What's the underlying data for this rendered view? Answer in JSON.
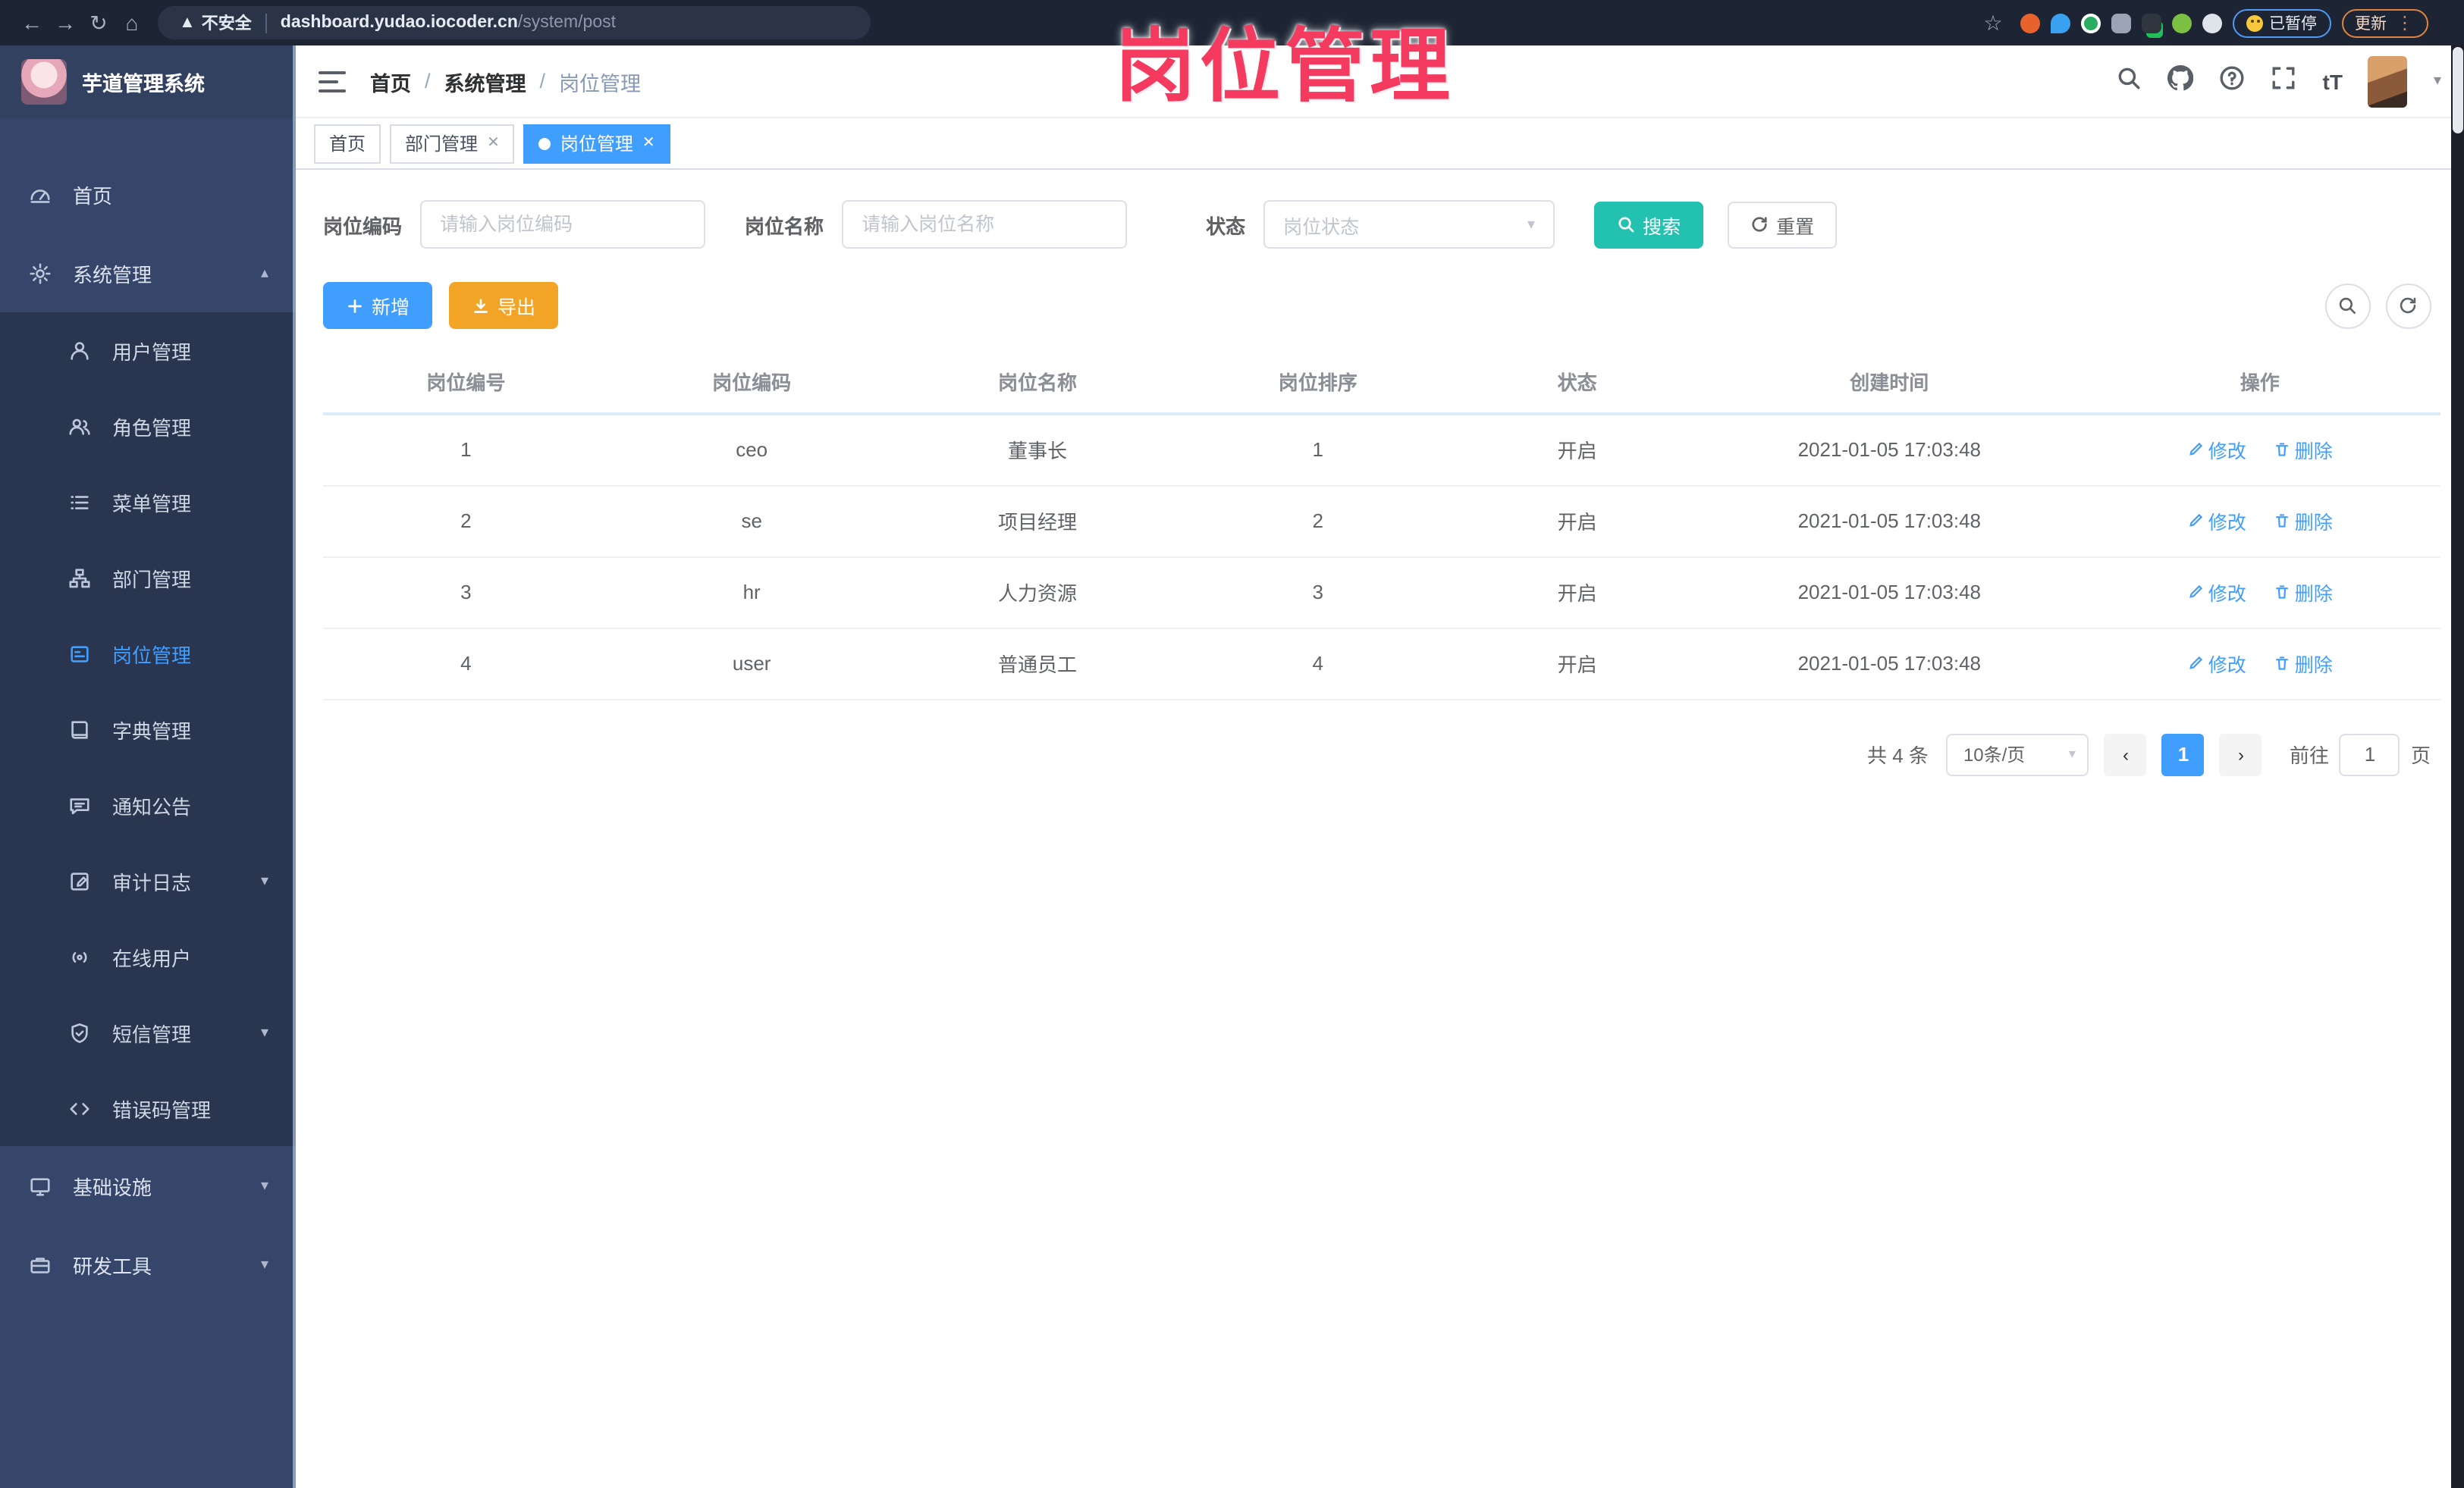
{
  "colors": {
    "accent": "#409eff",
    "search_teal": "#22c1b0",
    "export_orange": "#f2a426",
    "watermark_pink": "#f43a5f",
    "sidebar_bg": "#36466a",
    "submenu_bg": "#2a3650"
  },
  "watermark": "岗位管理",
  "browser": {
    "security_label": "不安全",
    "url_host": "dashboard.yudao.iocoder.cn",
    "url_path": "/system/post",
    "paused_label": "已暂停",
    "update_label": "更新"
  },
  "app": {
    "title": "芋道管理系统"
  },
  "breadcrumb": {
    "items": [
      "首页",
      "系统管理",
      "岗位管理"
    ]
  },
  "tabs": [
    {
      "label": "首页"
    },
    {
      "label": "部门管理"
    },
    {
      "label": "岗位管理"
    }
  ],
  "sidebar": {
    "items": [
      {
        "label": "首页"
      },
      {
        "label": "系统管理"
      },
      {
        "label": "用户管理"
      },
      {
        "label": "角色管理"
      },
      {
        "label": "菜单管理"
      },
      {
        "label": "部门管理"
      },
      {
        "label": "岗位管理"
      },
      {
        "label": "字典管理"
      },
      {
        "label": "通知公告"
      },
      {
        "label": "审计日志"
      },
      {
        "label": "在线用户"
      },
      {
        "label": "短信管理"
      },
      {
        "label": "错误码管理"
      },
      {
        "label": "基础设施"
      },
      {
        "label": "研发工具"
      }
    ]
  },
  "filters": {
    "post_code": {
      "label": "岗位编码",
      "placeholder": "请输入岗位编码",
      "value": ""
    },
    "post_name": {
      "label": "岗位名称",
      "placeholder": "请输入岗位名称",
      "value": ""
    },
    "status": {
      "label": "状态",
      "placeholder": "岗位状态"
    },
    "search_label": "搜索",
    "reset_label": "重置"
  },
  "toolbar": {
    "add_label": "新增",
    "export_label": "导出"
  },
  "table": {
    "headers": [
      "岗位编号",
      "岗位编码",
      "岗位名称",
      "岗位排序",
      "状态",
      "创建时间",
      "操作"
    ],
    "action_edit": "修改",
    "action_delete": "删除",
    "rows": [
      {
        "id": "1",
        "code": "ceo",
        "name": "董事长",
        "sort": "1",
        "status": "开启",
        "created": "2021-01-05 17:03:48"
      },
      {
        "id": "2",
        "code": "se",
        "name": "项目经理",
        "sort": "2",
        "status": "开启",
        "created": "2021-01-05 17:03:48"
      },
      {
        "id": "3",
        "code": "hr",
        "name": "人力资源",
        "sort": "3",
        "status": "开启",
        "created": "2021-01-05 17:03:48"
      },
      {
        "id": "4",
        "code": "user",
        "name": "普通员工",
        "sort": "4",
        "status": "开启",
        "created": "2021-01-05 17:03:48"
      }
    ]
  },
  "pagination": {
    "total_label": "共 4 条",
    "page_size": "10条/页",
    "current_page": "1",
    "goto_label": "前往",
    "goto_value": "1",
    "page_unit": "页"
  }
}
